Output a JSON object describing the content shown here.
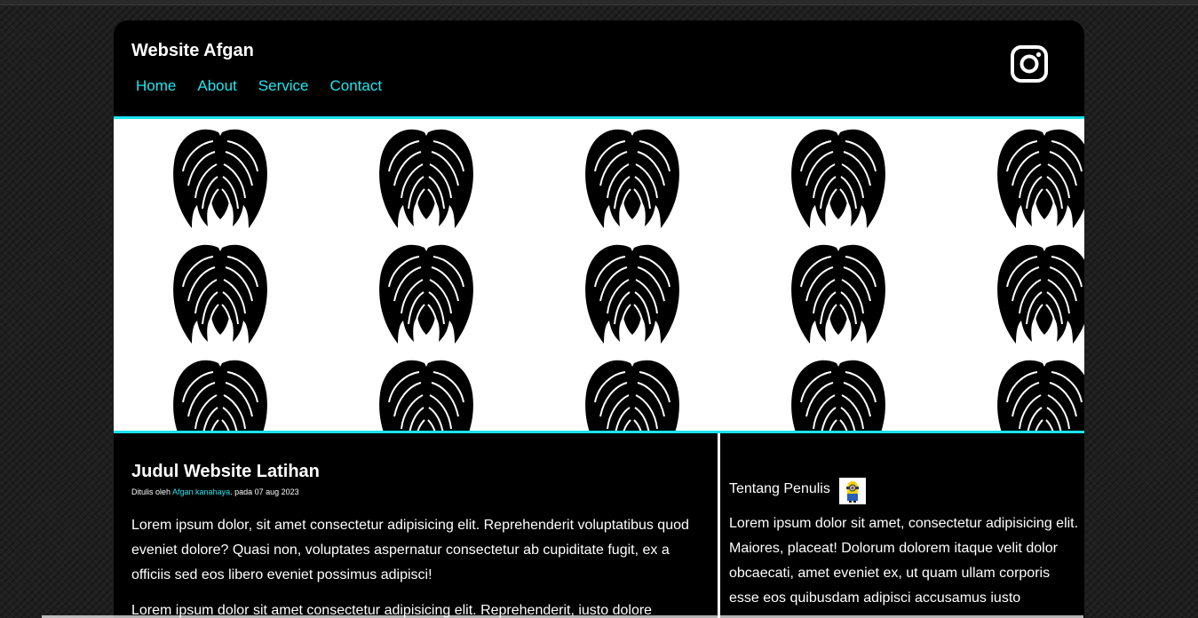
{
  "site": {
    "title": "Website Afgan"
  },
  "nav": {
    "items": [
      "Home",
      "About",
      "Service",
      "Contact"
    ]
  },
  "social": {
    "icon": "instagram-icon"
  },
  "hero": {
    "pattern_icon": "wings-icon"
  },
  "post": {
    "title": "Judul Website Latihan",
    "meta_prefix": "Ditulis oleh ",
    "author": "Afgan kanahaya",
    "meta_suffix": ". pada 07 aug 2023",
    "paragraph1": "Lorem ipsum dolor, sit amet consectetur adipisicing elit. Reprehenderit voluptatibus quod eveniet dolore? Quasi non, voluptates aspernatur consectetur ab cupiditate fugit, ex a officiis sed eos libero eveniet possimus adipisci!",
    "paragraph2": "Lorem ipsum dolor sit amet consectetur adipisicing elit. Reprehenderit, iusto dolore"
  },
  "sidebar": {
    "title": "Tentang Penulis",
    "avatar_icon": "minion-avatar-icon",
    "text": "Lorem ipsum dolor sit amet, consectetur adipisicing elit. Maiores, placeat! Dolorum dolorem itaque velit dolor obcaecati, amet eveniet ex, ut quam ullam corporis esse eos quibusdam adipisci accusamus iusto"
  },
  "colors": {
    "accent": "#1fe6f0",
    "background": "#000000"
  }
}
